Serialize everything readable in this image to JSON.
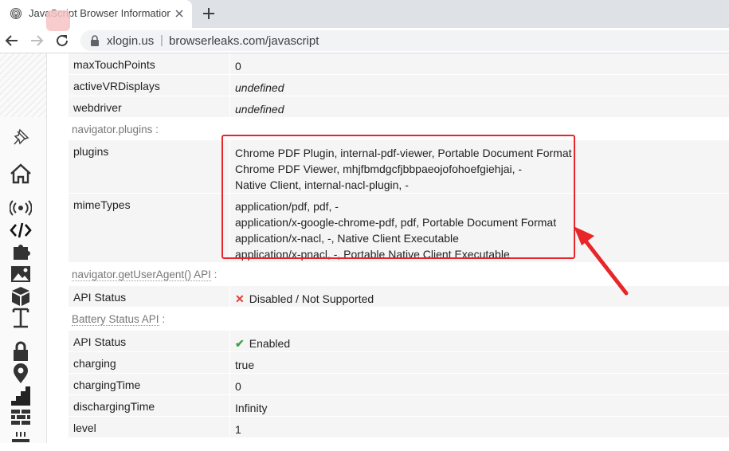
{
  "browser": {
    "tab_title": "JavaScript Browser Information",
    "url_host": "xlogin.us",
    "url_separator": "|",
    "url_path": "browserleaks.com/javascript"
  },
  "sidebar_icons": [
    "pin-icon",
    "home-icon",
    "broadcast-icon",
    "code-icon",
    "puzzle-icon",
    "image-icon",
    "cube-icon",
    "text-icon",
    "lock-icon",
    "map-pin-icon",
    "chart-steps-icon",
    "brick-wall-icon",
    "coffee-icon"
  ],
  "rows_top": [
    {
      "key": "maxTouchPoints",
      "value": "0",
      "italic": false
    },
    {
      "key": "activeVRDisplays",
      "value": "undefined",
      "italic": true
    },
    {
      "key": "webdriver",
      "value": "undefined",
      "italic": true
    }
  ],
  "sections": {
    "plugins_header": "navigator.plugins :",
    "useragent_header": "navigator.getUserAgent() API",
    "useragent_colon": " :",
    "battery_header": "Battery Status API",
    "battery_colon": " :"
  },
  "plugins": {
    "key": "plugins",
    "lines": [
      "Chrome PDF Plugin, internal-pdf-viewer, Portable Document Format",
      "Chrome PDF Viewer, mhjfbmdgcfjbbpaeojofohoefgiehjai, -",
      "Native Client, internal-nacl-plugin, -"
    ]
  },
  "mimetypes": {
    "key": "mimeTypes",
    "lines": [
      "application/pdf, pdf, -",
      "application/x-google-chrome-pdf, pdf, Portable Document Format",
      "application/x-nacl, -, Native Client Executable",
      "application/x-pnacl, -, Portable Native Client Executable"
    ]
  },
  "useragent": {
    "key": "API Status",
    "status": "Disabled / Not Supported"
  },
  "battery": [
    {
      "key": "API Status",
      "value": "Enabled"
    },
    {
      "key": "charging",
      "value": "true"
    },
    {
      "key": "chargingTime",
      "value": "0"
    },
    {
      "key": "dischargingTime",
      "value": "Infinity"
    },
    {
      "key": "level",
      "value": "1"
    }
  ],
  "colors": {
    "annotation": "#e8262a",
    "disabled": "#e53935",
    "enabled": "#43a047"
  }
}
